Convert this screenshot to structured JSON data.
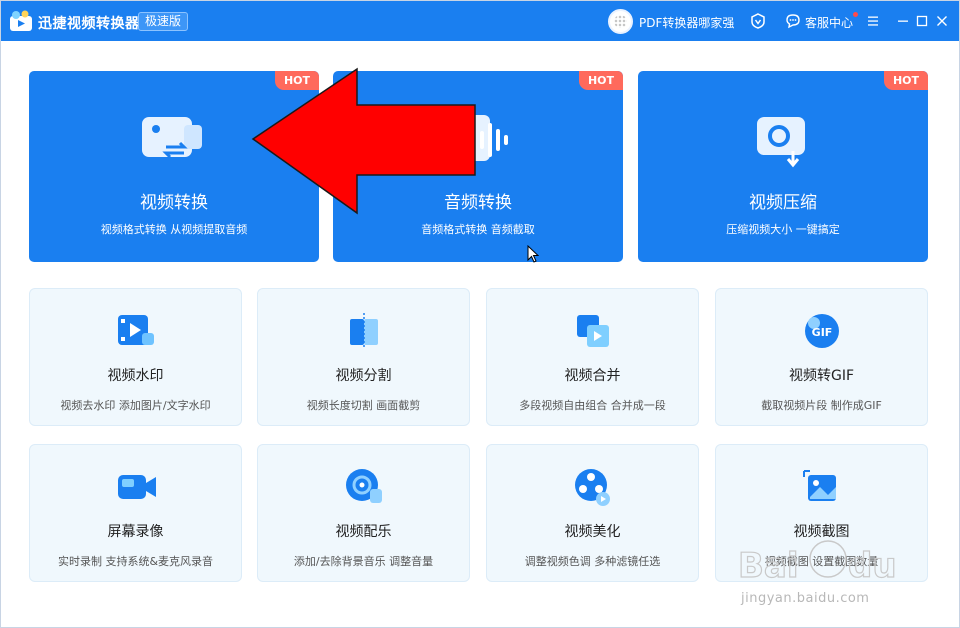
{
  "app": {
    "title": "迅捷视频转换器",
    "edition": "极速版",
    "username": "PDF转换器哪家强",
    "service_label": "客服中心",
    "colors": {
      "primary": "#1a7ff0",
      "hot": "#ff6a5c",
      "card_bg": "#f0f8fd"
    }
  },
  "featured": [
    {
      "title": "视频转换",
      "desc": "视频格式转换 从视频提取音频",
      "badge": "HOT",
      "icon": "video-convert-icon"
    },
    {
      "title": "音频转换",
      "desc": "音频格式转换 音频截取",
      "badge": "HOT",
      "icon": "audio-convert-icon"
    },
    {
      "title": "视频压缩",
      "desc": "压缩视频大小 一键搞定",
      "badge": "HOT",
      "icon": "video-compress-icon"
    }
  ],
  "tools": [
    {
      "title": "视频水印",
      "desc": "视频去水印 添加图片/文字水印",
      "icon": "video-watermark-icon"
    },
    {
      "title": "视频分割",
      "desc": "视频长度切割 画面截剪",
      "icon": "video-split-icon"
    },
    {
      "title": "视频合并",
      "desc": "多段视频自由组合 合并成一段",
      "icon": "video-merge-icon"
    },
    {
      "title": "视频转GIF",
      "desc": "截取视频片段 制作成GIF",
      "icon": "video-gif-icon"
    },
    {
      "title": "屏幕录像",
      "desc": "实时录制 支持系统&麦克风录音",
      "icon": "screen-record-icon"
    },
    {
      "title": "视频配乐",
      "desc": "添加/去除背景音乐 调整音量",
      "icon": "video-music-icon"
    },
    {
      "title": "视频美化",
      "desc": "调整视频色调 多种滤镜任选",
      "icon": "video-beautify-icon"
    },
    {
      "title": "视频截图",
      "desc": "视频截图 设置截图数量",
      "icon": "video-screenshot-icon"
    }
  ],
  "overlays": {
    "arrow_color": "#ff0000",
    "watermark_text": "jingyan.baidu.com"
  }
}
